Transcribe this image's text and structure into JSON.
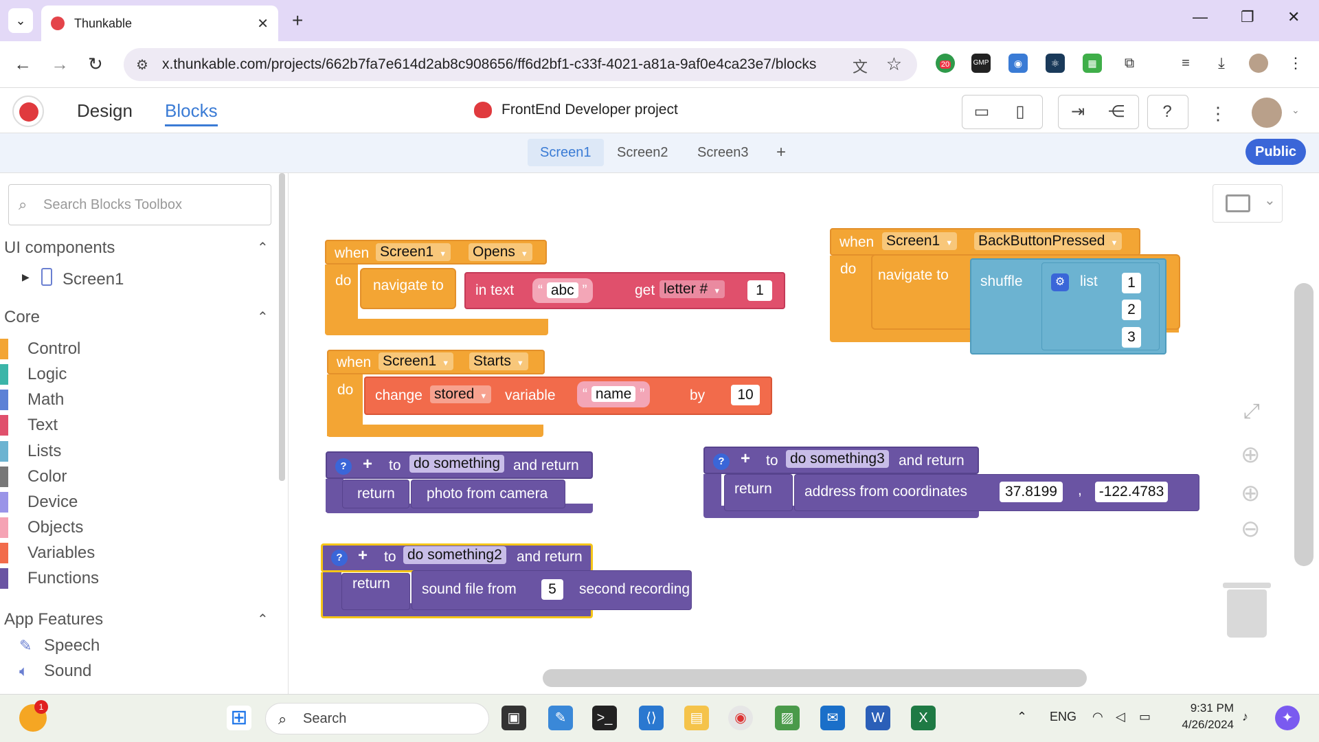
{
  "browser": {
    "tab_title": "Thunkable",
    "url": "x.thunkable.com/projects/662b7fa7e614d2ab8c908656/ff6d2bf1-c33f-4021-a81a-9af0e4ca23e7/blocks",
    "ext_badge": "20",
    "ext_gmp": "GMP"
  },
  "app": {
    "nav_design": "Design",
    "nav_blocks": "Blocks",
    "project_name": "FrontEnd Developer project",
    "screens": [
      "Screen1",
      "Screen2",
      "Screen3"
    ],
    "add_screen": "+",
    "public_label": "Public"
  },
  "sidebar": {
    "search_placeholder": "Search Blocks Toolbox",
    "ui_components": "UI components",
    "screen_item": "Screen1",
    "core": "Core",
    "categories": [
      {
        "label": "Control",
        "color": "#f3a534"
      },
      {
        "label": "Logic",
        "color": "#3bb5a8"
      },
      {
        "label": "Math",
        "color": "#5c81d6"
      },
      {
        "label": "Text",
        "color": "#e0506c"
      },
      {
        "label": "Lists",
        "color": "#6cb3d1"
      },
      {
        "label": "Color",
        "color": "#777777"
      },
      {
        "label": "Device",
        "color": "#9a94e8"
      },
      {
        "label": "Objects",
        "color": "#f5a3b4"
      },
      {
        "label": "Variables",
        "color": "#f26b4b"
      },
      {
        "label": "Functions",
        "color": "#6a54a3"
      }
    ],
    "app_features": "App Features",
    "features": [
      {
        "label": "Speech",
        "icon": "speech-icon"
      },
      {
        "label": "Sound",
        "icon": "sound-icon"
      }
    ]
  },
  "blocks": {
    "b1": {
      "when": "when",
      "screen": "Screen1",
      "event": "Opens",
      "do": "do",
      "navigate": "navigate to",
      "intext": "in text",
      "str": "abc",
      "get": "get",
      "letter": "letter #",
      "num": "1"
    },
    "b2": {
      "when": "when",
      "screen": "Screen1",
      "event": "Starts",
      "do": "do",
      "change": "change",
      "stored": "stored",
      "variable": "variable",
      "str": "name",
      "by": "by",
      "num": "10"
    },
    "b3": {
      "when": "when",
      "screen": "Screen1",
      "event": "BackButtonPressed",
      "do": "do",
      "navigate": "navigate to",
      "shuffle": "shuffle",
      "list": "list",
      "items": [
        "1",
        "2",
        "3"
      ]
    },
    "f1": {
      "to": "to",
      "name": "do something",
      "and_return": "and return",
      "return": "return",
      "value": "photo from camera"
    },
    "f2": {
      "to": "to",
      "name": "do something2",
      "and_return": "and return",
      "return": "return",
      "value": "sound file from",
      "num": "5",
      "suffix": "second recording"
    },
    "f3": {
      "to": "to",
      "name": "do something3",
      "and_return": "and return",
      "return": "return",
      "value": "address from coordinates",
      "lat": "37.8199",
      "comma": ",",
      "lng": "-122.4783"
    }
  },
  "taskbar": {
    "search_label": "Search",
    "lang": "ENG",
    "time": "9:31 PM",
    "date": "4/26/2024",
    "weather_badge": "1"
  },
  "colors": {
    "event_orange": "#f3a534",
    "event_border": "#e3902a",
    "text_pink": "#e0506c",
    "list_blue": "#6cb3d1",
    "function_purple": "#6a54a3",
    "accent_blue": "#3a7bd5"
  }
}
